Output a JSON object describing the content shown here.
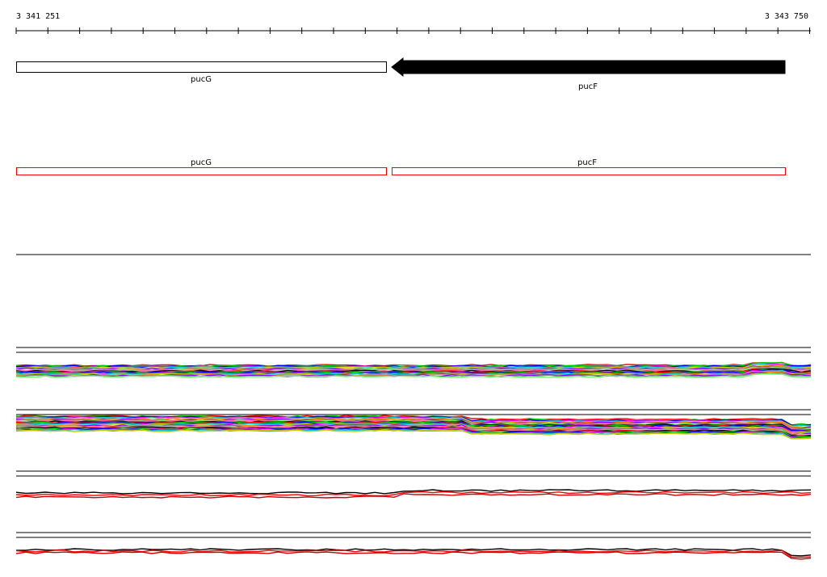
{
  "ruler": {
    "start_label": "3 341 251",
    "end_label": "3 343 750"
  },
  "genes": [
    {
      "name": "pucG",
      "strand": "forward",
      "fill": "#ffffff",
      "stroke": "#000000"
    },
    {
      "name": "pucF",
      "strand": "reverse",
      "fill": "#000000",
      "stroke": "#000000"
    }
  ],
  "features": [
    {
      "name": "pucG",
      "stroke": "#ff0000"
    },
    {
      "name": "pucF",
      "stroke": "#ff0000"
    }
  ],
  "colors": {
    "axis": "#000000",
    "feature_outline": "#ff0000",
    "profile_palette": [
      "#ff0000",
      "#00cc00",
      "#0000ff",
      "#ff00ff",
      "#00cccc",
      "#cccc00",
      "#ff8800",
      "#8800ff",
      "#888888",
      "#66ff66",
      "#ff66aa",
      "#000000"
    ]
  }
}
